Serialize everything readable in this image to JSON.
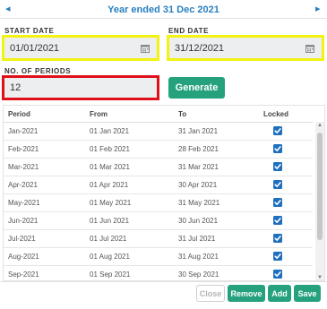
{
  "header": {
    "title": "Year ended 31 Dec 2021",
    "prev_icon": "caret-left-icon",
    "next_icon": "caret-right-icon"
  },
  "form": {
    "start_date": {
      "label": "START DATE",
      "value": "01/01/2021"
    },
    "end_date": {
      "label": "END DATE",
      "value": "31/12/2021"
    },
    "periods": {
      "label": "NO. OF PERIODS",
      "value": "12"
    },
    "generate_label": "Generate"
  },
  "table": {
    "columns": {
      "period": "Period",
      "from": "From",
      "to": "To",
      "locked": "Locked"
    },
    "rows": [
      {
        "period": "Jan-2021",
        "from": "01 Jan 2021",
        "to": "31 Jan 2021",
        "locked": true
      },
      {
        "period": "Feb-2021",
        "from": "01 Feb 2021",
        "to": "28 Feb 2021",
        "locked": true
      },
      {
        "period": "Mar-2021",
        "from": "01 Mar 2021",
        "to": "31 Mar 2021",
        "locked": true
      },
      {
        "period": "Apr-2021",
        "from": "01 Apr 2021",
        "to": "30 Apr 2021",
        "locked": true
      },
      {
        "period": "May-2021",
        "from": "01 May 2021",
        "to": "31 May 2021",
        "locked": true
      },
      {
        "period": "Jun-2021",
        "from": "01 Jun 2021",
        "to": "30 Jun 2021",
        "locked": true
      },
      {
        "period": "Jul-2021",
        "from": "01 Jul 2021",
        "to": "31 Jul 2021",
        "locked": true
      },
      {
        "period": "Aug-2021",
        "from": "01 Aug 2021",
        "to": "31 Aug 2021",
        "locked": true
      },
      {
        "period": "Sep-2021",
        "from": "01 Sep 2021",
        "to": "30 Sep 2021",
        "locked": true
      }
    ]
  },
  "footer": {
    "close_label": "Close",
    "remove_label": "Remove",
    "add_label": "Add",
    "save_label": "Save"
  },
  "colors": {
    "accent": "#2a7fc0",
    "primary_button": "#26a17e",
    "highlight_yellow": "#f2f213",
    "highlight_red": "#e0101a",
    "field_bg": "#eceeef"
  }
}
